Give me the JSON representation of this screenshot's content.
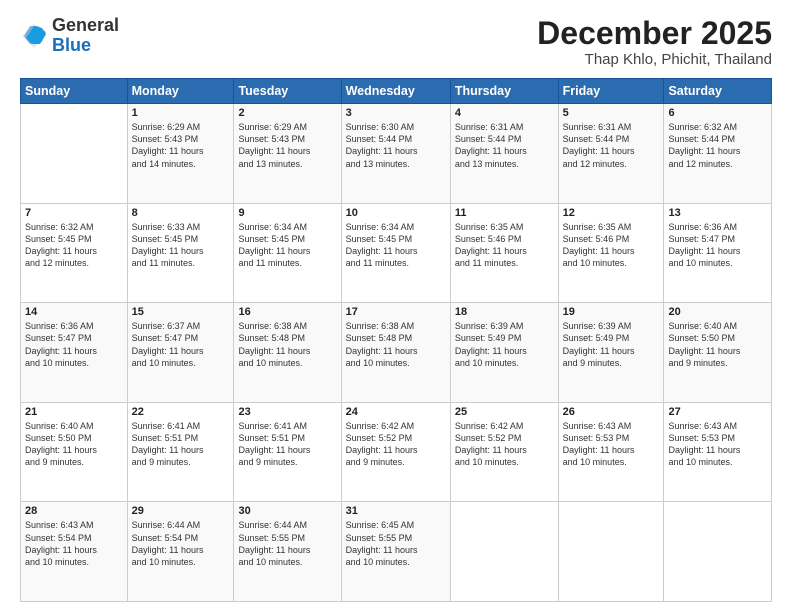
{
  "header": {
    "logo_general": "General",
    "logo_blue": "Blue",
    "month": "December 2025",
    "location": "Thap Khlo, Phichit, Thailand"
  },
  "weekdays": [
    "Sunday",
    "Monday",
    "Tuesday",
    "Wednesday",
    "Thursday",
    "Friday",
    "Saturday"
  ],
  "weeks": [
    [
      {
        "day": "",
        "text": ""
      },
      {
        "day": "1",
        "text": "Sunrise: 6:29 AM\nSunset: 5:43 PM\nDaylight: 11 hours\nand 14 minutes."
      },
      {
        "day": "2",
        "text": "Sunrise: 6:29 AM\nSunset: 5:43 PM\nDaylight: 11 hours\nand 13 minutes."
      },
      {
        "day": "3",
        "text": "Sunrise: 6:30 AM\nSunset: 5:44 PM\nDaylight: 11 hours\nand 13 minutes."
      },
      {
        "day": "4",
        "text": "Sunrise: 6:31 AM\nSunset: 5:44 PM\nDaylight: 11 hours\nand 13 minutes."
      },
      {
        "day": "5",
        "text": "Sunrise: 6:31 AM\nSunset: 5:44 PM\nDaylight: 11 hours\nand 12 minutes."
      },
      {
        "day": "6",
        "text": "Sunrise: 6:32 AM\nSunset: 5:44 PM\nDaylight: 11 hours\nand 12 minutes."
      }
    ],
    [
      {
        "day": "7",
        "text": "Sunrise: 6:32 AM\nSunset: 5:45 PM\nDaylight: 11 hours\nand 12 minutes."
      },
      {
        "day": "8",
        "text": "Sunrise: 6:33 AM\nSunset: 5:45 PM\nDaylight: 11 hours\nand 11 minutes."
      },
      {
        "day": "9",
        "text": "Sunrise: 6:34 AM\nSunset: 5:45 PM\nDaylight: 11 hours\nand 11 minutes."
      },
      {
        "day": "10",
        "text": "Sunrise: 6:34 AM\nSunset: 5:45 PM\nDaylight: 11 hours\nand 11 minutes."
      },
      {
        "day": "11",
        "text": "Sunrise: 6:35 AM\nSunset: 5:46 PM\nDaylight: 11 hours\nand 11 minutes."
      },
      {
        "day": "12",
        "text": "Sunrise: 6:35 AM\nSunset: 5:46 PM\nDaylight: 11 hours\nand 10 minutes."
      },
      {
        "day": "13",
        "text": "Sunrise: 6:36 AM\nSunset: 5:47 PM\nDaylight: 11 hours\nand 10 minutes."
      }
    ],
    [
      {
        "day": "14",
        "text": "Sunrise: 6:36 AM\nSunset: 5:47 PM\nDaylight: 11 hours\nand 10 minutes."
      },
      {
        "day": "15",
        "text": "Sunrise: 6:37 AM\nSunset: 5:47 PM\nDaylight: 11 hours\nand 10 minutes."
      },
      {
        "day": "16",
        "text": "Sunrise: 6:38 AM\nSunset: 5:48 PM\nDaylight: 11 hours\nand 10 minutes."
      },
      {
        "day": "17",
        "text": "Sunrise: 6:38 AM\nSunset: 5:48 PM\nDaylight: 11 hours\nand 10 minutes."
      },
      {
        "day": "18",
        "text": "Sunrise: 6:39 AM\nSunset: 5:49 PM\nDaylight: 11 hours\nand 10 minutes."
      },
      {
        "day": "19",
        "text": "Sunrise: 6:39 AM\nSunset: 5:49 PM\nDaylight: 11 hours\nand 9 minutes."
      },
      {
        "day": "20",
        "text": "Sunrise: 6:40 AM\nSunset: 5:50 PM\nDaylight: 11 hours\nand 9 minutes."
      }
    ],
    [
      {
        "day": "21",
        "text": "Sunrise: 6:40 AM\nSunset: 5:50 PM\nDaylight: 11 hours\nand 9 minutes."
      },
      {
        "day": "22",
        "text": "Sunrise: 6:41 AM\nSunset: 5:51 PM\nDaylight: 11 hours\nand 9 minutes."
      },
      {
        "day": "23",
        "text": "Sunrise: 6:41 AM\nSunset: 5:51 PM\nDaylight: 11 hours\nand 9 minutes."
      },
      {
        "day": "24",
        "text": "Sunrise: 6:42 AM\nSunset: 5:52 PM\nDaylight: 11 hours\nand 9 minutes."
      },
      {
        "day": "25",
        "text": "Sunrise: 6:42 AM\nSunset: 5:52 PM\nDaylight: 11 hours\nand 10 minutes."
      },
      {
        "day": "26",
        "text": "Sunrise: 6:43 AM\nSunset: 5:53 PM\nDaylight: 11 hours\nand 10 minutes."
      },
      {
        "day": "27",
        "text": "Sunrise: 6:43 AM\nSunset: 5:53 PM\nDaylight: 11 hours\nand 10 minutes."
      }
    ],
    [
      {
        "day": "28",
        "text": "Sunrise: 6:43 AM\nSunset: 5:54 PM\nDaylight: 11 hours\nand 10 minutes."
      },
      {
        "day": "29",
        "text": "Sunrise: 6:44 AM\nSunset: 5:54 PM\nDaylight: 11 hours\nand 10 minutes."
      },
      {
        "day": "30",
        "text": "Sunrise: 6:44 AM\nSunset: 5:55 PM\nDaylight: 11 hours\nand 10 minutes."
      },
      {
        "day": "31",
        "text": "Sunrise: 6:45 AM\nSunset: 5:55 PM\nDaylight: 11 hours\nand 10 minutes."
      },
      {
        "day": "",
        "text": ""
      },
      {
        "day": "",
        "text": ""
      },
      {
        "day": "",
        "text": ""
      }
    ]
  ]
}
